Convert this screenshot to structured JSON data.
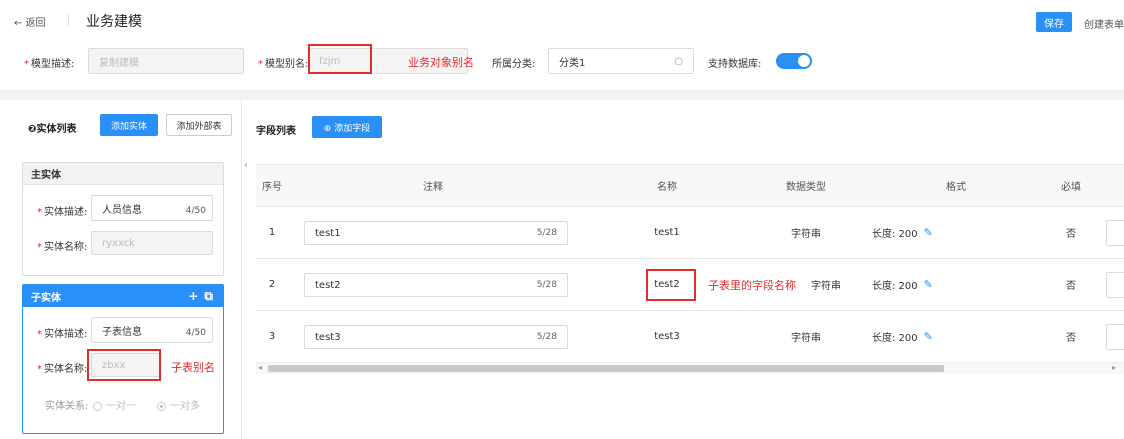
{
  "header": {
    "back_label": "← 返回",
    "title": "业务建模",
    "save_label": "保存",
    "create_form_label": "创建表单"
  },
  "form": {
    "model_desc_label": "模型描述:",
    "model_desc_value": "复制建模",
    "model_alias_label": "模型别名:",
    "model_alias_value": "fzjm",
    "model_alias_annotation": "业务对象别名",
    "category_label": "所属分类:",
    "category_value": "分类1",
    "support_db_label": "支持数据库:",
    "support_db_on": true
  },
  "entity_panel": {
    "title": "❷实体列表",
    "add_entity_label": "添加实体",
    "add_external_label": "添加外部表",
    "main_entity": {
      "header": "主实体",
      "desc_label": "实体描述:",
      "desc_value": "人员信息",
      "desc_counter": "4/50",
      "name_label": "实体名称:",
      "name_value": "ryxxck"
    },
    "sub_entity": {
      "header": "子实体",
      "add_icon": "+",
      "copy_icon": "⧉",
      "desc_label": "实体描述:",
      "desc_value": "子表信息",
      "desc_counter": "4/50",
      "name_label": "实体名称:",
      "name_value": "zbxx",
      "name_annotation": "子表别名",
      "relation_label": "实体关系:",
      "relation_one_to_one": "一对一",
      "relation_one_to_many": "一对多"
    }
  },
  "field_panel": {
    "title": "字段列表",
    "add_field_label": "⊕ 添加字段",
    "columns": [
      "序号",
      "注释",
      "名称",
      "数据类型",
      "格式",
      "必填"
    ],
    "rows": [
      {
        "index": "1",
        "comment": "test1",
        "comment_counter": "5/28",
        "name": "test1",
        "type": "字符串",
        "format": "长度: 200",
        "required": "否"
      },
      {
        "index": "2",
        "comment": "test2",
        "comment_counter": "5/28",
        "name": "test2",
        "type": "字符串",
        "format": "长度: 200",
        "required": "否"
      },
      {
        "index": "3",
        "comment": "test3",
        "comment_counter": "5/28",
        "name": "test3",
        "type": "字符串",
        "format": "长度: 200",
        "required": "否"
      }
    ],
    "name_annotation": "子表里的字段名称"
  },
  "colors": {
    "primary": "#2a8ff7",
    "annotation_red": "#e52b2b"
  }
}
